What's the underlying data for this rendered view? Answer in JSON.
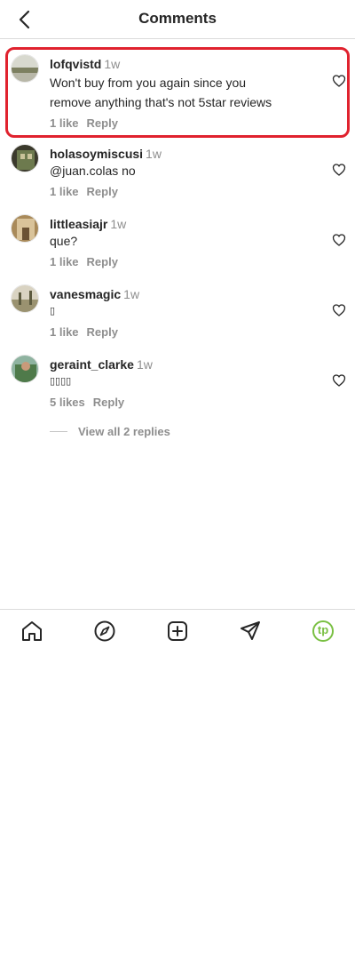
{
  "header": {
    "title": "Comments"
  },
  "comments": [
    {
      "user": "lofqvistd",
      "time": "1w",
      "text_line1": "Won't buy from you again since you",
      "text_line2": "remove anything that's not 5star reviews",
      "likes": "1 like",
      "reply": "Reply"
    },
    {
      "user": "holasoymiscusi",
      "time": "1w",
      "text": "@juan.colas no",
      "likes": "1 like",
      "reply": "Reply"
    },
    {
      "user": "littleasiajr",
      "time": "1w",
      "text": "que?",
      "likes": "1 like",
      "reply": "Reply"
    },
    {
      "user": "vanesmagic",
      "time": "1w",
      "text": "▯",
      "likes": "1 like",
      "reply": "Reply"
    },
    {
      "user": "geraint_clarke",
      "time": "1w",
      "text": "▯▯▯▯",
      "likes": "5 likes",
      "reply": "Reply"
    }
  ],
  "view_replies": "View all 2 replies",
  "tabbar": {
    "items": [
      "home-icon",
      "explore-icon",
      "new-post-icon",
      "direct-icon",
      "profile-icon"
    ],
    "profile_initials": "tp",
    "profile_color": "#7ac043"
  },
  "colors": {
    "highlight": "#e0222e",
    "muted": "#8e8e8e",
    "text": "#262626"
  }
}
